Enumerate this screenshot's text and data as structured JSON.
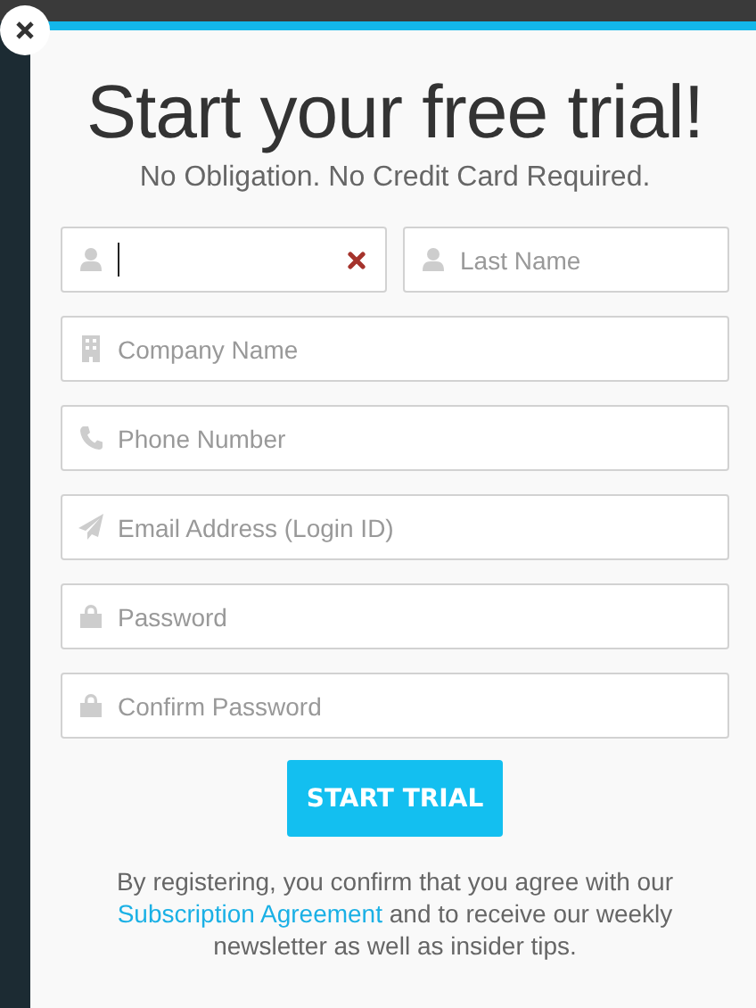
{
  "title": "Start your free trial!",
  "subtitle": "No Obligation. No Credit Card Required.",
  "name_row": [
    {
      "kind": "name",
      "focused": true,
      "invalid": true
    },
    {
      "kind": "name",
      "placeholder": "Last Name",
      "focused": false,
      "invalid": false
    }
  ],
  "fields": [
    {
      "kind": "company",
      "placeholder": "Company Name"
    },
    {
      "kind": "phone",
      "placeholder": "Phone Number"
    },
    {
      "kind": "email",
      "placeholder": "Email Address (Login ID)"
    },
    {
      "kind": "password",
      "placeholder": "Password"
    },
    {
      "kind": "password",
      "placeholder": "Confirm Password"
    }
  ],
  "submit": "START TRIAL",
  "legal": {
    "before": "By registering, you confirm that you agree with our",
    "link": "Subscription Agreement",
    "after": "and to receive our weekly newsletter as well as insider tips."
  }
}
